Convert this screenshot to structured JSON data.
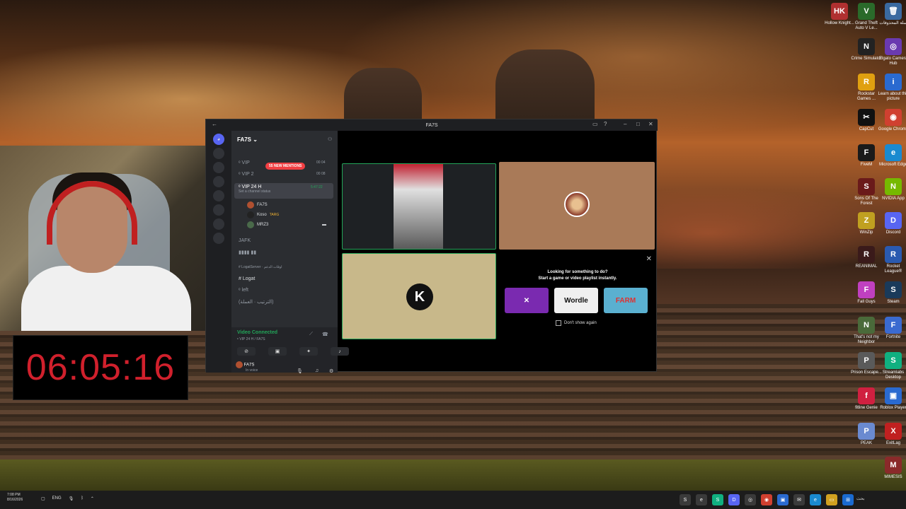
{
  "desktop": {
    "icons": [
      {
        "label": "Hollow Knight...",
        "glyph": "HK",
        "color": "#b03030"
      },
      {
        "label": "Grand Theft Auto V Le...",
        "glyph": "V",
        "color": "#2a6a2a"
      },
      {
        "label": "سلة المحذوفات",
        "glyph": "🗑",
        "color": "#3a6aa0"
      },
      {
        "label": "Crime Simulator",
        "glyph": "N",
        "color": "#222222"
      },
      {
        "label": "Elgato Camera Hub",
        "glyph": "◎",
        "color": "#6a3ab0"
      },
      {
        "label": "Rockstar Games ...",
        "glyph": "R",
        "color": "#e0a010"
      },
      {
        "label": "Learn about this picture",
        "glyph": "i",
        "color": "#2a6ad0"
      },
      {
        "label": "CapCut",
        "glyph": "✂",
        "color": "#111111"
      },
      {
        "label": "Google Chrome",
        "glyph": "◉",
        "color": "#d04030"
      },
      {
        "label": "FiveM",
        "glyph": "F",
        "color": "#1a1a1a"
      },
      {
        "label": "Microsoft Edge",
        "glyph": "e",
        "color": "#1a8ad0"
      },
      {
        "label": "Sons Of The Forest",
        "glyph": "S",
        "color": "#6a1a1a"
      },
      {
        "label": "NVIDIA App",
        "glyph": "N",
        "color": "#76b900"
      },
      {
        "label": "WinZip",
        "glyph": "Z",
        "color": "#c0a020"
      },
      {
        "label": "Discord",
        "glyph": "D",
        "color": "#5865f2"
      },
      {
        "label": "REANIMAL",
        "glyph": "R",
        "color": "#3a1a1a"
      },
      {
        "label": "Rocket League®",
        "glyph": "R",
        "color": "#2a5ab0"
      },
      {
        "label": "Fall Guys",
        "glyph": "F",
        "color": "#c040c0"
      },
      {
        "label": "Steam",
        "glyph": "S",
        "color": "#1a3a5a"
      },
      {
        "label": "That's not my Neighbor",
        "glyph": "N",
        "color": "#4a6a3a"
      },
      {
        "label": "Fortnite",
        "glyph": "F",
        "color": "#3a6ad0"
      },
      {
        "label": "Prison Escape...",
        "glyph": "P",
        "color": "#5a5a5a"
      },
      {
        "label": "Streamlabs Desktop",
        "glyph": "S",
        "color": "#10b080"
      },
      {
        "label": "fitline Genie",
        "glyph": "f",
        "color": "#d02040"
      },
      {
        "label": "Roblox Player",
        "glyph": "▣",
        "color": "#2a6ad0"
      },
      {
        "label": "PEAK",
        "glyph": "P",
        "color": "#6a8ad0"
      },
      {
        "label": "ExitLag",
        "glyph": "X",
        "color": "#c02020"
      },
      {
        "label": "MIMESIS",
        "glyph": "M",
        "color": "#8a2a2a"
      }
    ]
  },
  "timer": {
    "value": "06:05:16"
  },
  "discord": {
    "window_title": "FA7S",
    "server_name": "FA7S ⌄",
    "mentions_badge": "55 NEW MENTIONS",
    "channels": [
      {
        "name": "ᵉ VIP",
        "count": "00 04"
      },
      {
        "name": "ᵉ VIP 2",
        "count": "00 08"
      },
      {
        "name": "ᵉ VIP 24 H",
        "status": "Set a channel status",
        "timer": "5:47:22"
      },
      {
        "name": "JAFK"
      },
      {
        "name": "▮▮▮▮ ▮▮"
      }
    ],
    "voice_users": [
      "FA7S",
      "Koso",
      "MRZ3"
    ],
    "koso_tag": "TARG",
    "category": "# LogatServer · اوقات الدعم",
    "text_channels": [
      "# Logat",
      "ᵉ left",
      "(الترتيب · العملة)"
    ],
    "voice_status": "Video Connected",
    "voice_channel": "ᵉ VIP 24 H / FA7S",
    "user_name": "FA7S",
    "user_status": "In voice",
    "activity_prompt_line1": "Looking for something to do?",
    "activity_prompt_line2": "Start a game or video playlist instantly.",
    "games": [
      {
        "label": "✕",
        "color": "#7a2ab0"
      },
      {
        "label": "Wordle",
        "color": "#f0f0f0"
      },
      {
        "label": "FARM",
        "color": "#5ab0d0"
      }
    ],
    "dont_show": "Don't show again",
    "tile_logo": "K"
  },
  "taskbar": {
    "time": "7:08 PM",
    "date": "8/16/2026",
    "lang": "ENG",
    "search_label": "بحث"
  }
}
